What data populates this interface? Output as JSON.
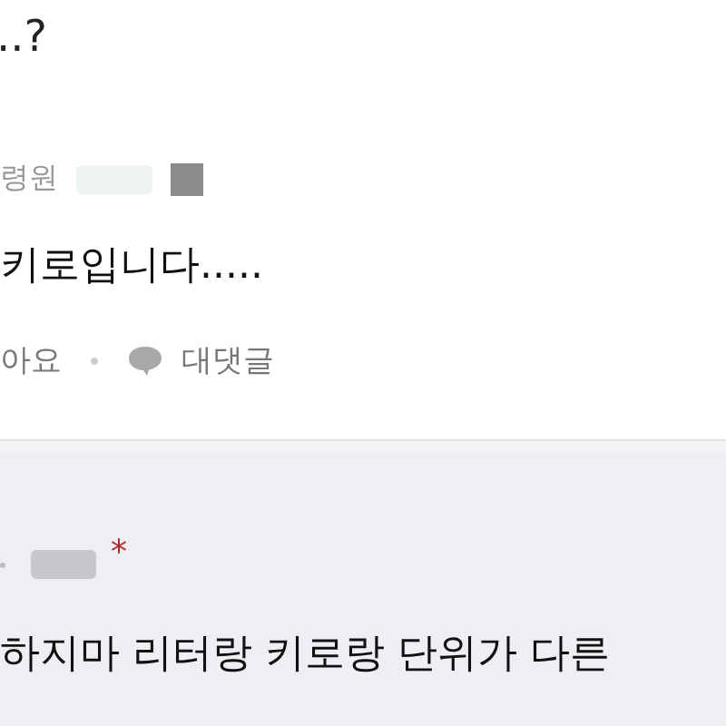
{
  "comment": {
    "previous_text": "..?",
    "author": "령원",
    "body": "키로입니다.....",
    "actions": [
      {
        "kind": "like",
        "label": "아요"
      },
      {
        "kind": "reply",
        "label": "대댓글"
      }
    ]
  },
  "reply": {
    "marker": "*",
    "body": "하지마 리터랑 키로랑 단위가 다른"
  }
}
